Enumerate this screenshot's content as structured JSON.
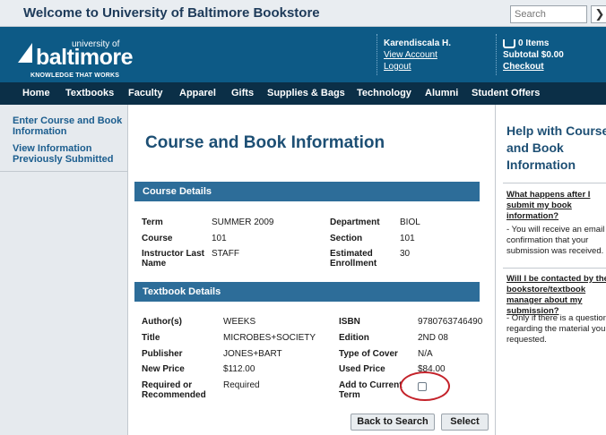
{
  "topbar": {
    "welcome": "Welcome to University of Baltimore Bookstore",
    "search_placeholder": "Search",
    "search_go": "❯"
  },
  "logo": {
    "university": "university of",
    "name": "baltimore",
    "tagline": "KNOWLEDGE THAT WORKS"
  },
  "user": {
    "name": "Karendiscala H.",
    "view_account": "View Account",
    "logout": "Logout"
  },
  "cart": {
    "items": "0 Items",
    "subtotal": "Subtotal $0.00",
    "checkout": "Checkout"
  },
  "nav": [
    "Home",
    "Textbooks",
    "Faculty",
    "Apparel",
    "Gifts",
    "Supplies & Bags",
    "Technology",
    "Alumni",
    "Student Offers"
  ],
  "sidebar": {
    "enter_course": "Enter Course and Book Information",
    "view_info": "View Information Previously Submitted"
  },
  "main": {
    "title": "Course and Book Information",
    "course_section": "Course Details",
    "course": {
      "term_label": "Term",
      "term": "SUMMER 2009",
      "course_label": "Course",
      "course": "101",
      "instructor_label": "Instructor Last Name",
      "instructor": "STAFF",
      "department_label": "Department",
      "department": "BIOL",
      "section_label": "Section",
      "section": "101",
      "enrollment_label": "Estimated Enrollment",
      "enrollment": "30"
    },
    "textbook_section": "Textbook Details",
    "textbook": {
      "author_label": "Author(s)",
      "author": "WEEKS",
      "title_label": "Title",
      "title": "MICROBES+SOCIETY",
      "publisher_label": "Publisher",
      "publisher": "JONES+BART",
      "new_price_label": "New Price",
      "new_price": "$112.00",
      "required_label": "Required or Recommended",
      "required": "Required",
      "isbn_label": "ISBN",
      "isbn": "9780763746490",
      "edition_label": "Edition",
      "edition": "2ND 08",
      "cover_label": "Type of Cover",
      "cover": "N/A",
      "used_price_label": "Used Price",
      "used_price": "$84.00",
      "add_label": "Add to Current Term"
    },
    "back_button": "Back to Search",
    "select_button": "Select"
  },
  "help": {
    "title": "Help with Course and Book Information",
    "q1": "What happens after I submit my book information?",
    "a1": "- You will receive an email confirmation that your submission was received.",
    "q2": "Will I be contacted by the bookstore/textbook manager about my submission?",
    "a2": "- Only if there is a question regarding the material you requested."
  },
  "colors": {
    "header": "#0d5a86",
    "nav": "#0b2f47",
    "section": "#2d6d99",
    "accent_ring": "#c4222a"
  }
}
